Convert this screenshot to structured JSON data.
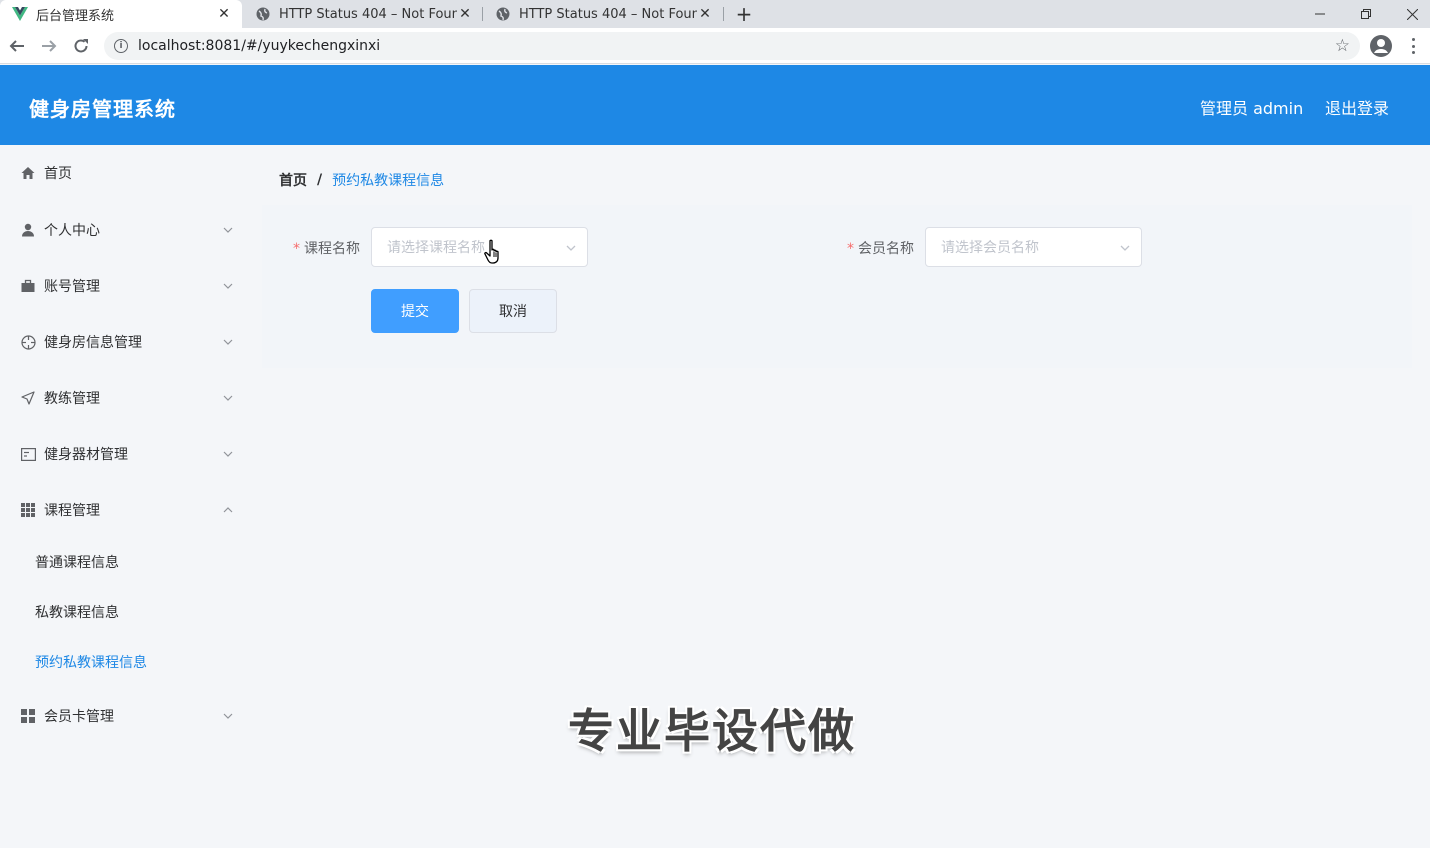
{
  "browser": {
    "tabs": [
      {
        "title": "后台管理系统",
        "active": true,
        "favicon": "vue-logo-icon"
      },
      {
        "title": "HTTP Status 404 – Not Found",
        "active": false,
        "favicon": "globe-icon"
      },
      {
        "title": "HTTP Status 404 – Not Found",
        "active": false,
        "favicon": "globe-icon"
      }
    ],
    "url": "localhost:8081/#/yuykechengxinxi"
  },
  "header": {
    "title": "健身房管理系统",
    "user": "管理员 admin",
    "logout": "退出登录",
    "bg_color": "#1e88e5"
  },
  "sidebar": {
    "items": [
      {
        "label": "首页",
        "icon": "home-icon"
      },
      {
        "label": "个人中心",
        "icon": "user-icon"
      },
      {
        "label": "账号管理",
        "icon": "briefcase-icon"
      },
      {
        "label": "健身房信息管理",
        "icon": "crosshair-icon"
      },
      {
        "label": "教练管理",
        "icon": "send-icon"
      },
      {
        "label": "健身器材管理",
        "icon": "id-card-icon"
      },
      {
        "label": "课程管理",
        "icon": "grid-icon",
        "expanded": true
      },
      {
        "label": "会员卡管理",
        "icon": "apps-icon"
      }
    ],
    "sub_items": [
      {
        "label": "普通课程信息"
      },
      {
        "label": "私教课程信息"
      },
      {
        "label": "预约私教课程信息",
        "active": true
      }
    ],
    "active_color": "#1e88e5"
  },
  "breadcrumb": {
    "home": "首页",
    "separator": "/",
    "current": "预约私教课程信息"
  },
  "form": {
    "course": {
      "label": "课程名称",
      "placeholder": "请选择课程名称"
    },
    "member": {
      "label": "会员名称",
      "placeholder": "请选择会员名称"
    },
    "required_mark": "*",
    "submit": "提交",
    "cancel": "取消"
  },
  "watermark": "专业毕设代做"
}
